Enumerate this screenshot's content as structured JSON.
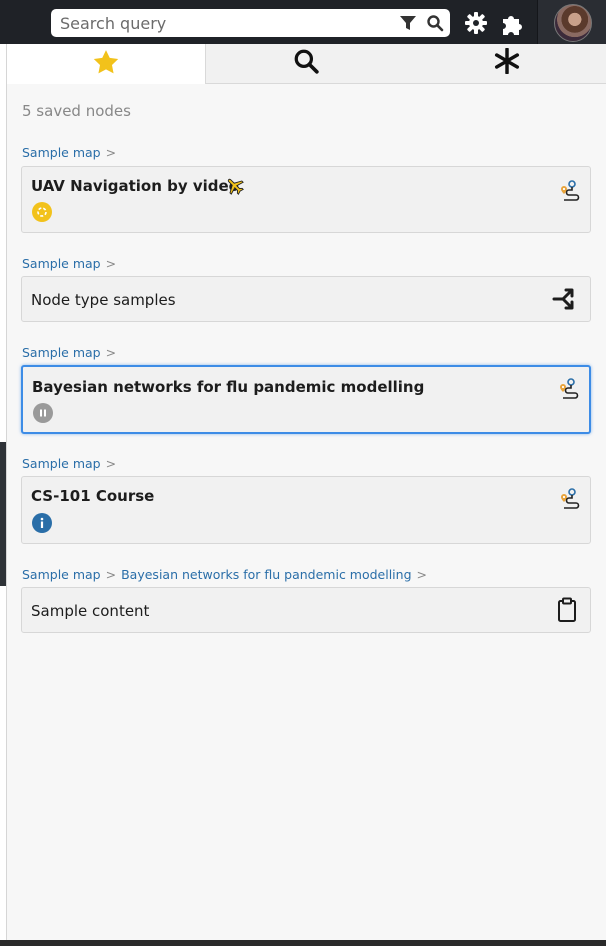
{
  "search": {
    "placeholder": "Search query"
  },
  "panel": {
    "tabs": [
      {
        "name": "favorites",
        "icon": "star-icon",
        "active": true
      },
      {
        "name": "search",
        "icon": "search-icon",
        "active": false
      },
      {
        "name": "all",
        "icon": "asterisk-icon",
        "active": false
      }
    ],
    "saved_count": "5 saved nodes",
    "items": [
      {
        "breadcrumb": [
          "Sample map"
        ],
        "title": "UAV Navigation by video",
        "type_icon": "map-route-icon",
        "status_icon": "yellow-dot-icon"
      },
      {
        "breadcrumb": [
          "Sample map"
        ],
        "title": "Node type samples",
        "type_icon": "merge-arrows-icon"
      },
      {
        "breadcrumb": [
          "Sample map"
        ],
        "title": "Bayesian networks for flu pandemic modelling",
        "type_icon": "map-route-icon",
        "status_icon": "pause-icon",
        "focused": true
      },
      {
        "breadcrumb": [
          "Sample map"
        ],
        "title": "CS-101 Course",
        "type_icon": "map-route-icon",
        "status_icon": "info-icon"
      },
      {
        "breadcrumb": [
          "Sample map",
          "Bayesian networks for flu pandemic modelling"
        ],
        "title": "Sample content",
        "type_icon": "clipboard-icon"
      }
    ],
    "crumb_separator": ">"
  },
  "colors": {
    "accent": "#3d8ce6",
    "link": "#2a6ea8",
    "star": "#f2c21b",
    "topbar": "#1f2227"
  }
}
